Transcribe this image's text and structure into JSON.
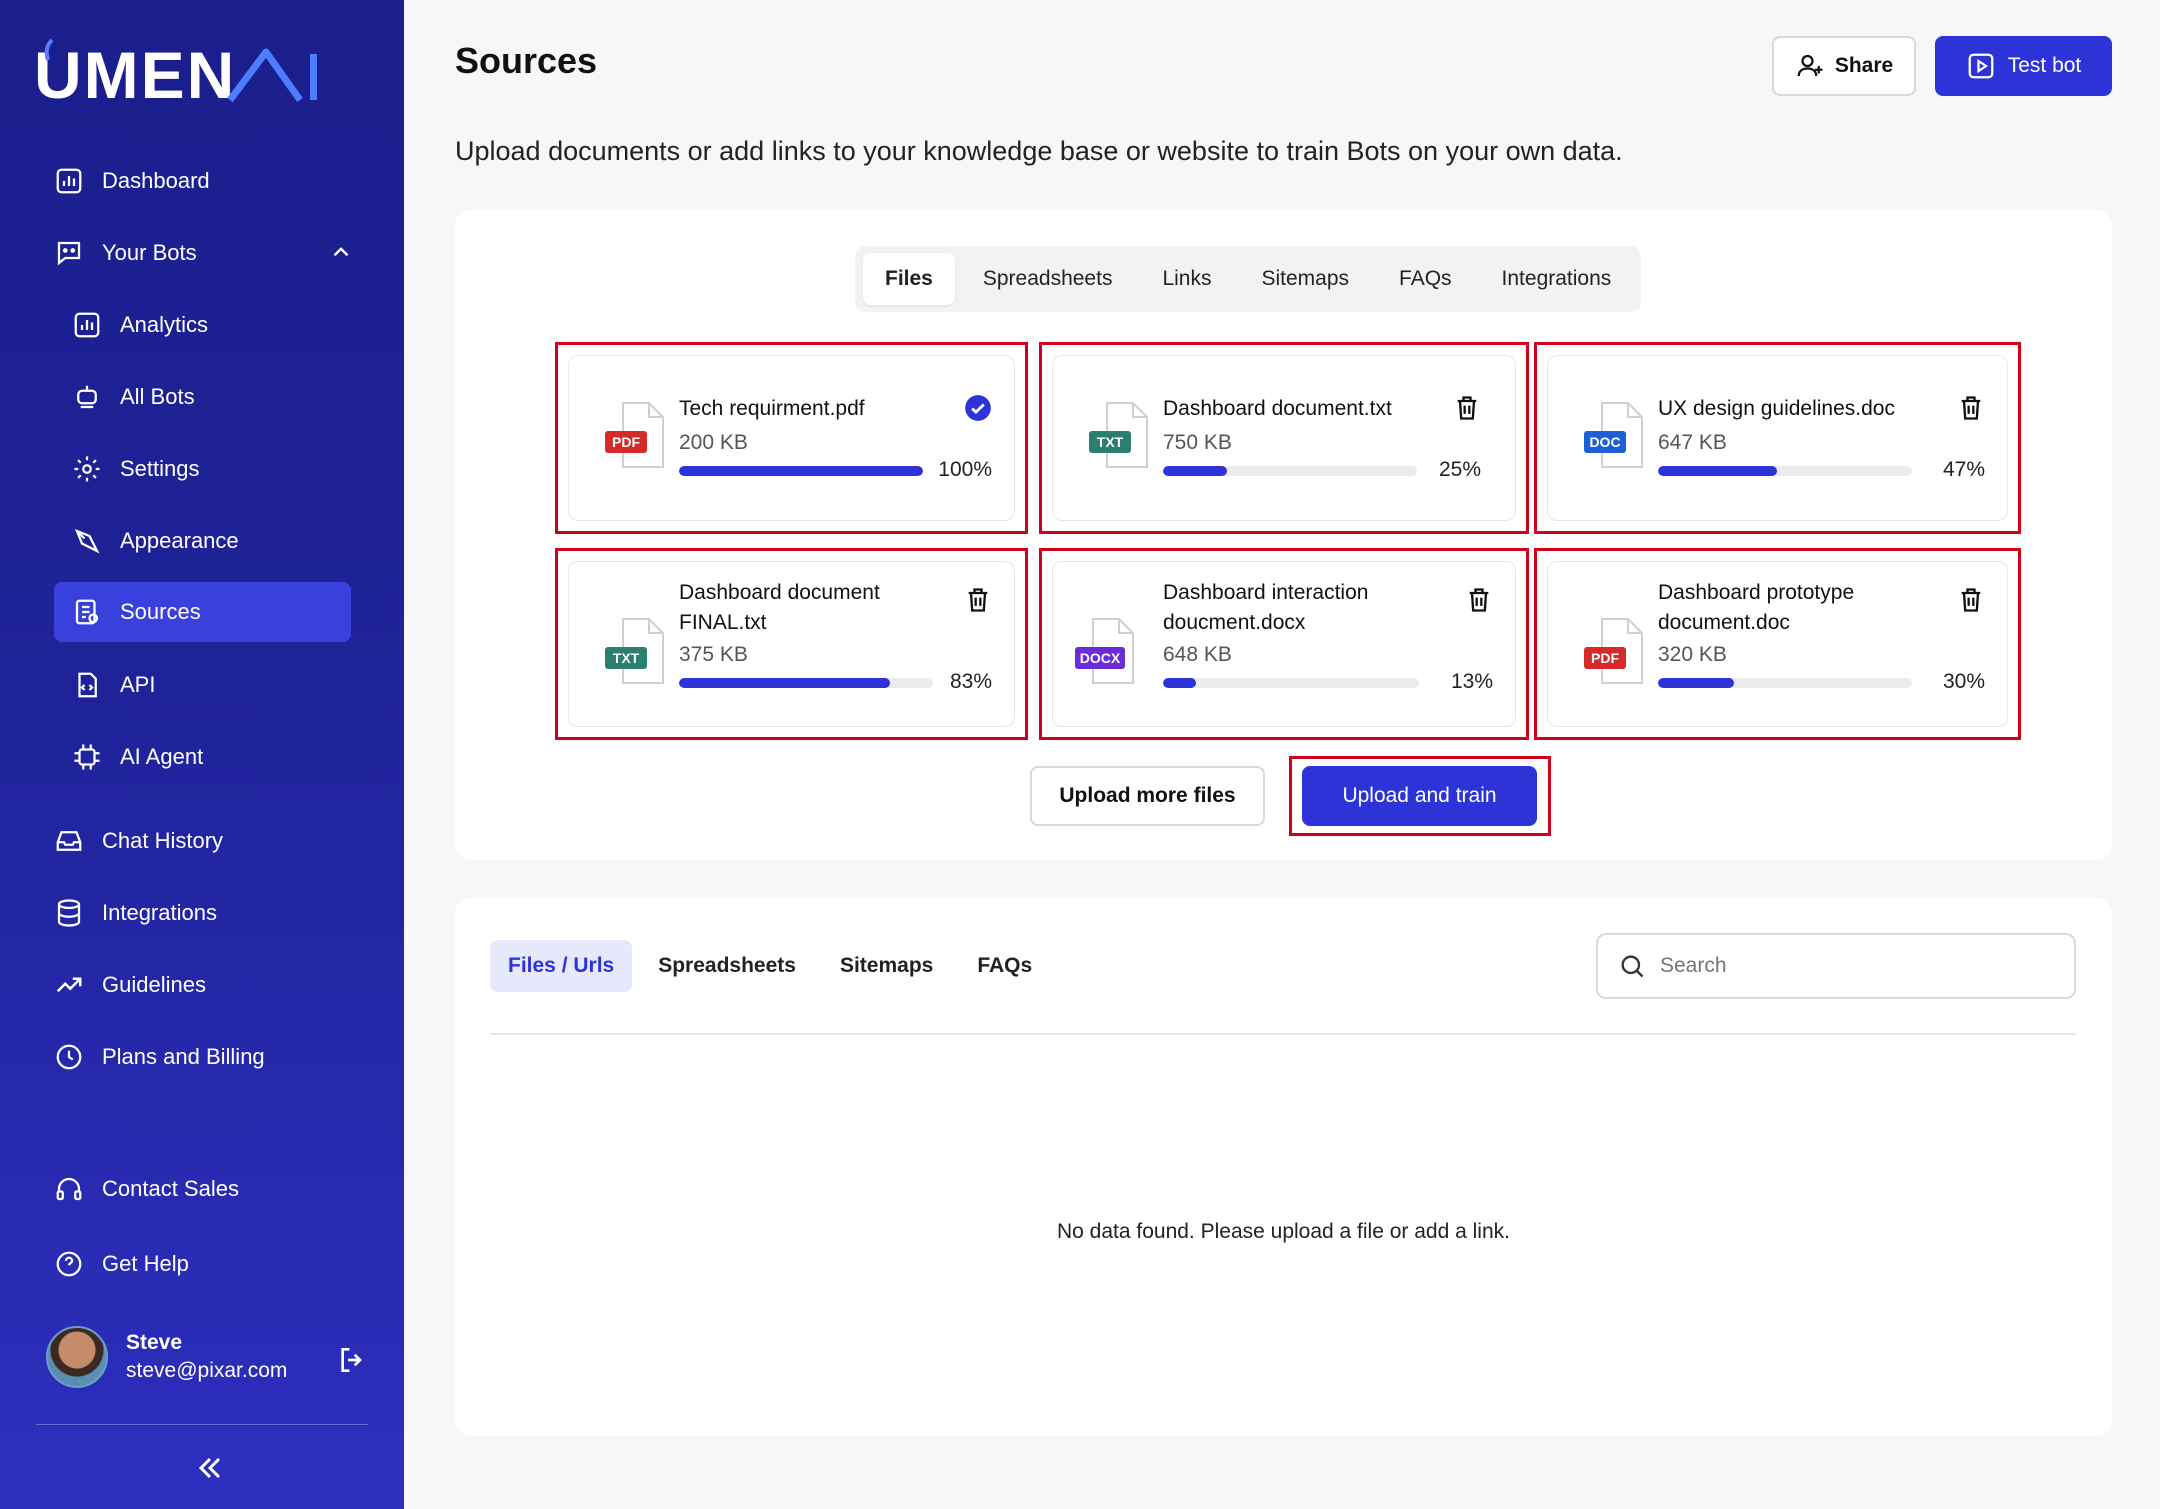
{
  "brand": {
    "logo_text": "UMEN AI"
  },
  "sidebar": {
    "items": [
      {
        "label": "Dashboard"
      },
      {
        "label": "Your Bots"
      },
      {
        "label": "Analytics"
      },
      {
        "label": "All Bots"
      },
      {
        "label": "Settings"
      },
      {
        "label": "Appearance"
      },
      {
        "label": "Sources"
      },
      {
        "label": "API"
      },
      {
        "label": "AI Agent"
      },
      {
        "label": "Chat History"
      },
      {
        "label": "Integrations"
      },
      {
        "label": "Guidelines"
      },
      {
        "label": "Plans and Billing"
      },
      {
        "label": "Contact Sales"
      },
      {
        "label": "Get Help"
      }
    ],
    "user": {
      "name": "Steve",
      "email": "steve@pixar.com"
    }
  },
  "header": {
    "title": "Sources",
    "share_label": "Share",
    "test_label": "Test bot",
    "subtitle": "Upload documents or add links to your knowledge base or website to train Bots on your own data."
  },
  "upload": {
    "tabs": [
      "Files",
      "Spreadsheets",
      "Links",
      "Sitemaps",
      "FAQs",
      "Integrations"
    ],
    "active_tab": "Files",
    "files": [
      {
        "name": "Tech requirment.pdf",
        "size": "200 KB",
        "progress": 100,
        "progress_label": "100%",
        "type": "PDF",
        "done": true
      },
      {
        "name": "Dashboard document.txt",
        "size": "750 KB",
        "progress": 25,
        "progress_label": "25%",
        "type": "TXT",
        "done": false
      },
      {
        "name": "UX design guidelines.doc",
        "size": "647 KB",
        "progress": 47,
        "progress_label": "47%",
        "type": "DOC",
        "done": false
      },
      {
        "name": "Dashboard document FINAL.txt",
        "size": "375 KB",
        "progress": 83,
        "progress_label": "83%",
        "type": "TXT",
        "done": false
      },
      {
        "name": "Dashboard interaction doucment.docx",
        "size": "648 KB",
        "progress": 13,
        "progress_label": "13%",
        "type": "DOCX",
        "done": false
      },
      {
        "name": "Dashboard prototype document.doc",
        "size": "320 KB",
        "progress": 30,
        "progress_label": "30%",
        "type": "PDF",
        "done": false
      }
    ],
    "upload_more_label": "Upload more files",
    "train_label": "Upload and train"
  },
  "sources": {
    "tabs": [
      "Files / Urls",
      "Spreadsheets",
      "Sitemaps",
      "FAQs"
    ],
    "active_tab": "Files / Urls",
    "search_placeholder": "Search",
    "empty_message": "No data found. Please upload a file or add a link."
  },
  "colors": {
    "accent": "#2d33d6",
    "sidebar": "#1f2399",
    "highlight": "#d0021b",
    "pdf": "#d42a2a",
    "txt": "#2a7f6e",
    "doc": "#1f5fd6",
    "docx": "#6a2bd9"
  }
}
